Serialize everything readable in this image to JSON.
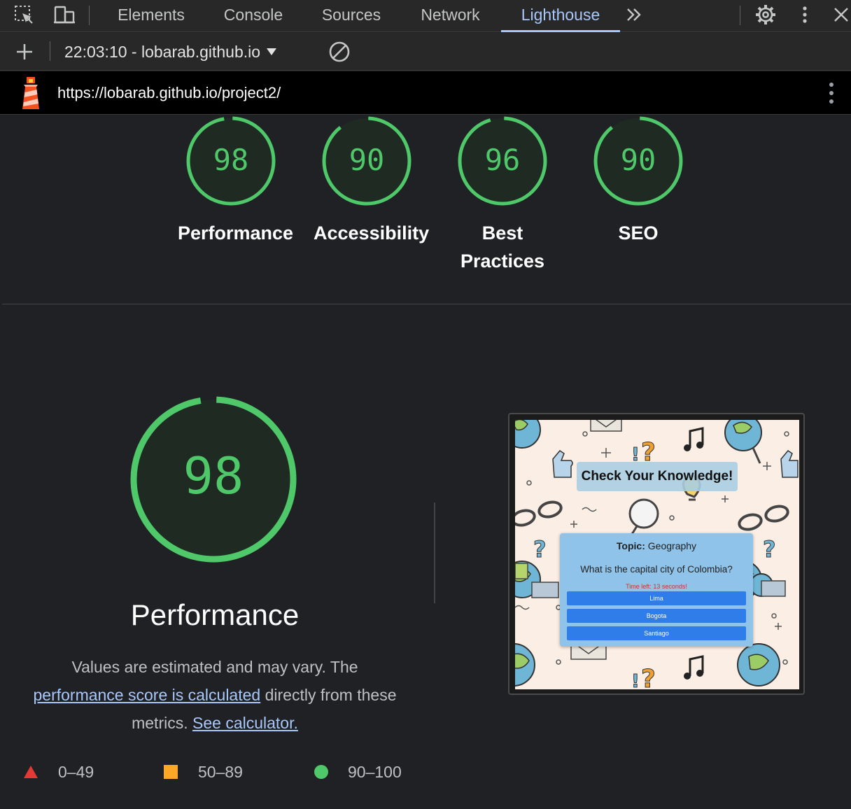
{
  "devtools": {
    "tabs": [
      {
        "label": "Elements"
      },
      {
        "label": "Console"
      },
      {
        "label": "Sources"
      },
      {
        "label": "Network"
      },
      {
        "label": "Lighthouse"
      }
    ],
    "active_tab": "Lighthouse",
    "accent_color": "#a8c7fa"
  },
  "toolbar": {
    "report_label": "22:03:10 - lobarab.github.io"
  },
  "urlbar": {
    "url": "https://lobarab.github.io/project2/"
  },
  "categories": [
    {
      "score": "98",
      "label": "Performance"
    },
    {
      "score": "90",
      "label": "Accessibility"
    },
    {
      "score": "96",
      "label": "Best Practices"
    },
    {
      "score": "90",
      "label": "SEO"
    }
  ],
  "category_scores": [
    98,
    90,
    96,
    90
  ],
  "performance": {
    "score": "98",
    "score_value": 98,
    "title": "Performance",
    "desc_text1": "Values are estimated and may vary. The",
    "desc_link1": "performance score is calculated",
    "desc_text2": "directly from these metrics.",
    "desc_link2": "See calculator."
  },
  "legend": [
    {
      "range": "0–49",
      "color": "#e53935",
      "shape": "triangle"
    },
    {
      "range": "50–89",
      "color": "#ffa726",
      "shape": "square"
    },
    {
      "range": "90–100",
      "color": "#4fc86a",
      "shape": "circle"
    }
  ],
  "colors": {
    "pass": "#4fc86a",
    "gauge_fill": "#1f2a22"
  },
  "screenshot": {
    "app_title": "Check Your Knowledge!",
    "topic_label": "Topic:",
    "topic_value": "Geography",
    "question": "What is the capital city of Colombia?",
    "time_left": "Time left: 13 seconds!",
    "answers": [
      "Lima",
      "Bogota",
      "Santiago"
    ]
  }
}
